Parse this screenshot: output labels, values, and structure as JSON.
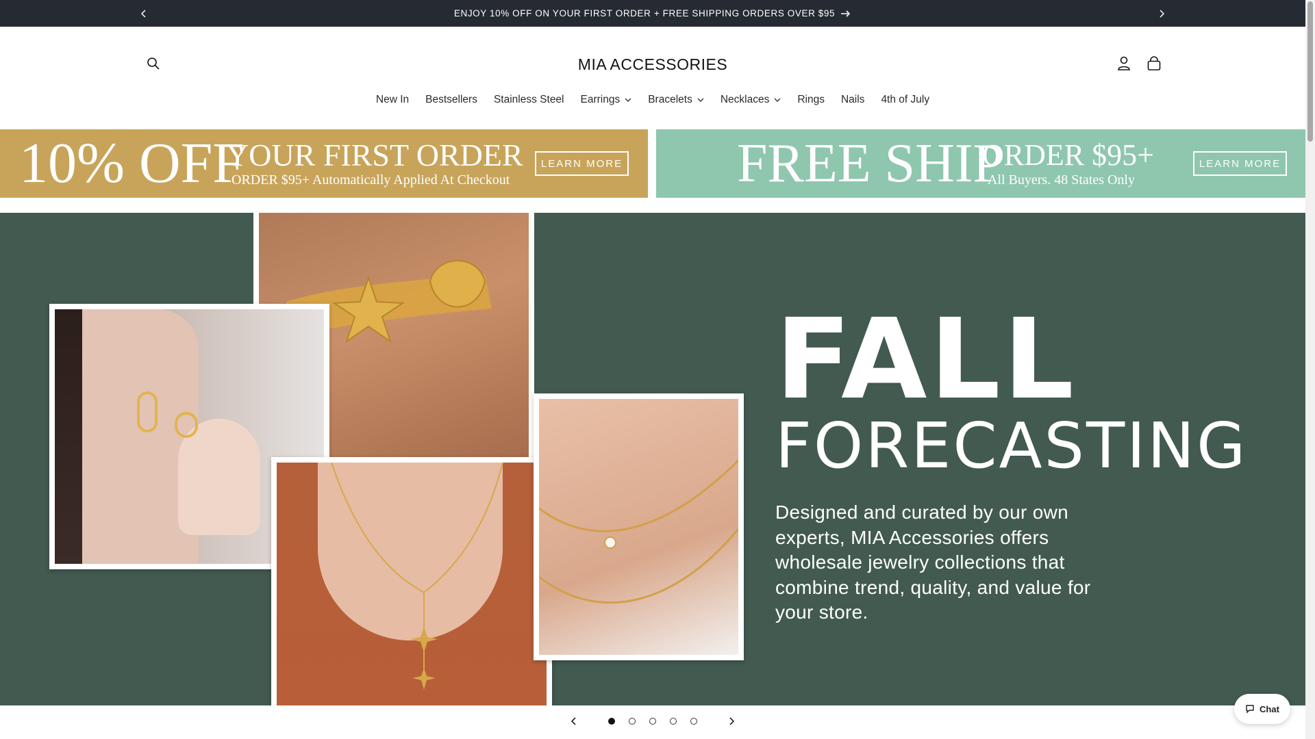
{
  "announcement": {
    "text": "ENJOY 10% OFF ON YOUR FIRST ORDER + FREE SHIPPING ORDERS OVER $95",
    "prev_icon": "chevron-left-icon",
    "next_icon": "chevron-right-icon"
  },
  "header": {
    "logo": "MIA ACCESSORIES",
    "icons": [
      "search-icon",
      "account-icon",
      "cart-icon"
    ]
  },
  "menu": {
    "items": [
      {
        "label": "New In",
        "dropdown": false
      },
      {
        "label": "Bestsellers",
        "dropdown": false
      },
      {
        "label": "Stainless Steel",
        "dropdown": false
      },
      {
        "label": "Earrings",
        "dropdown": true
      },
      {
        "label": "Bracelets",
        "dropdown": true
      },
      {
        "label": "Necklaces",
        "dropdown": true
      },
      {
        "label": "Rings",
        "dropdown": false
      },
      {
        "label": "Nails",
        "dropdown": false
      },
      {
        "label": "4th of July",
        "dropdown": false
      }
    ]
  },
  "promos": {
    "left": {
      "big": "10% OFF",
      "headline": "YOUR FIRST ORDER",
      "sub": "ORDER $95+ Automatically Applied At Checkout",
      "button": "LEARN MORE",
      "color": "#c8a45a"
    },
    "right": {
      "big": "FREE SHIP",
      "headline": "ORDER $95+",
      "sub": "All Buyers. 48 States Only",
      "button": "LEARN MORE",
      "color": "#8fc6ae"
    }
  },
  "hero": {
    "title_line1": "FALL",
    "title_line2": "FORECASTING",
    "description": "Designed and curated by our own experts, MIA Accessories offers wholesale jewelry collections that combine trend, quality, and value for your store.",
    "background": "#425a50"
  },
  "slider": {
    "slide_count": 5,
    "active_index": 0
  },
  "chat": {
    "label": "Chat"
  }
}
